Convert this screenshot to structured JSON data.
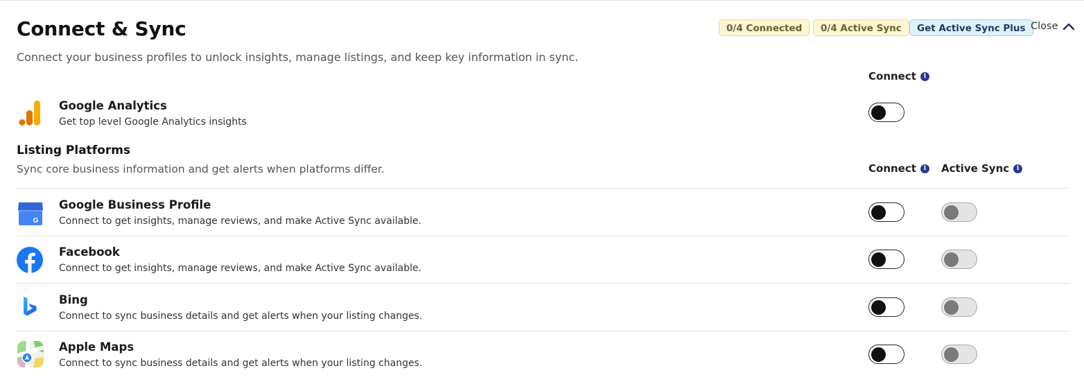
{
  "header": {
    "title": "Connect & Sync",
    "subtitle": "Connect your business profiles to unlock insights, manage listings, and keep key information in sync.",
    "badges": [
      {
        "label": "0/4 Connected"
      },
      {
        "label": "0/4 Active Sync"
      },
      {
        "label": "Get Active Sync Plus"
      }
    ],
    "close_label": "Close"
  },
  "analytics": {
    "connect_header": "Connect",
    "name": "Google Analytics",
    "desc": "Get top level Google Analytics insights",
    "icon": "google-analytics-icon"
  },
  "listing": {
    "title": "Listing Platforms",
    "subtitle": "Sync core business information and get alerts when platforms differ.",
    "connect_header": "Connect",
    "active_sync_header": "Active Sync",
    "rows": [
      {
        "name": "Google Business Profile",
        "desc": "Connect to get insights, manage reviews, and make Active Sync available.",
        "icon": "google-business-profile-icon"
      },
      {
        "name": "Facebook",
        "desc": "Connect to get insights, manage reviews, and make Active Sync available.",
        "icon": "facebook-icon"
      },
      {
        "name": "Bing",
        "desc": "Connect to sync business details and get alerts when your listing changes.",
        "icon": "bing-icon"
      },
      {
        "name": "Apple Maps",
        "desc": "Connect to sync business details and get alerts when your listing changes.",
        "icon": "apple-maps-icon"
      }
    ]
  },
  "colors": {
    "badge_yellow_bg": "#fdf6d3",
    "badge_blue_bg": "#dff1fb",
    "info_icon": "#2b3a91",
    "facebook_blue": "#1877f2",
    "google_analytics_orange": "#f9ab00"
  }
}
